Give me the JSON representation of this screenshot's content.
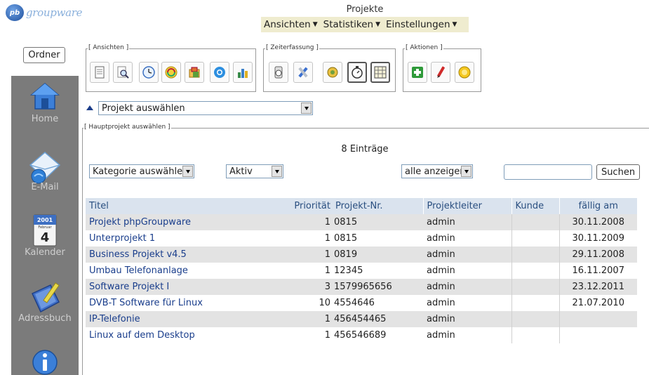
{
  "header": {
    "logo_badge": "pb",
    "logo_text": "groupware",
    "app_title": "Projekte",
    "menu": [
      {
        "label": "Ansichten"
      },
      {
        "label": "Statistiken"
      },
      {
        "label": "Einstellungen"
      }
    ]
  },
  "sidebar": {
    "ordner_label": "Ordner",
    "items": [
      {
        "label": "Home",
        "icon": "home-icon"
      },
      {
        "label": "E-Mail",
        "icon": "email-icon"
      },
      {
        "label": "Kalender",
        "icon": "calendar-icon"
      },
      {
        "label": "Adressbuch",
        "icon": "addressbook-icon"
      },
      {
        "label": "",
        "icon": "info-icon"
      }
    ],
    "calendar_icon_year": "2001",
    "calendar_icon_month": "Februar",
    "calendar_icon_day": "4"
  },
  "toolbar": {
    "ansichten_legend": "[ Ansichten ]",
    "zeiterfassung_legend": "[ Zeiterfassung ]",
    "aktionen_legend": "[ Aktionen ]",
    "ansichten_buttons": [
      "document-icon",
      "search-document-icon",
      "clock-icon",
      "refresh-icon",
      "folder-icon",
      "globe-icon",
      "chart-icon"
    ],
    "zeiterfassung_buttons": [
      "stopwatch-icon",
      "tools-icon",
      "gear-icon",
      "timer-icon",
      "timetable-icon"
    ],
    "aktionen_buttons": [
      "add-icon",
      "edit-icon",
      "smiley-icon"
    ]
  },
  "project_select": {
    "value": "Projekt auswählen"
  },
  "hauptprojekt": {
    "legend": "[ Hauptprojekt auswählen ]",
    "entries_count": "8 Einträge",
    "filters": {
      "kategorie": "Kategorie auswählen",
      "status": "Aktiv",
      "show": "alle anzeigen"
    },
    "search_value": "",
    "search_button": "Suchen"
  },
  "table": {
    "columns": [
      "Titel",
      "Priorität",
      "Projekt-Nr.",
      "Projektleiter",
      "Kunde",
      "fällig am"
    ],
    "rows": [
      {
        "title": "Projekt phpGroupware",
        "priority": "1",
        "number": "0815",
        "leader": "admin",
        "customer": "",
        "due": "30.11.2008"
      },
      {
        "title": "Unterprojekt 1",
        "priority": "1",
        "number": "0815",
        "leader": "admin",
        "customer": "",
        "due": "30.11.2009"
      },
      {
        "title": "Business Projekt v4.5",
        "priority": "1",
        "number": "0819",
        "leader": "admin",
        "customer": "",
        "due": "29.11.2008"
      },
      {
        "title": "Umbau Telefonanlage",
        "priority": "1",
        "number": "12345",
        "leader": "admin",
        "customer": "",
        "due": "16.11.2007"
      },
      {
        "title": "Software Projekt I",
        "priority": "3",
        "number": "1579965656",
        "leader": "admin",
        "customer": "",
        "due": "23.12.2011"
      },
      {
        "title": "DVB-T Software für Linux",
        "priority": "10",
        "number": "4554646",
        "leader": "admin",
        "customer": "",
        "due": "21.07.2010"
      },
      {
        "title": "IP-Telefonie",
        "priority": "1",
        "number": "456454465",
        "leader": "admin",
        "customer": "",
        "due": ""
      },
      {
        "title": "Linux auf dem Desktop",
        "priority": "1",
        "number": "456546689",
        "leader": "admin",
        "customer": "",
        "due": ""
      }
    ]
  },
  "colors": {
    "sidebar_bg": "#7b7b7b",
    "menu_bg": "#efeccf",
    "table_header_bg": "#dae3ee",
    "link": "#1a3e8c",
    "row_odd": "#e3e3e3"
  }
}
